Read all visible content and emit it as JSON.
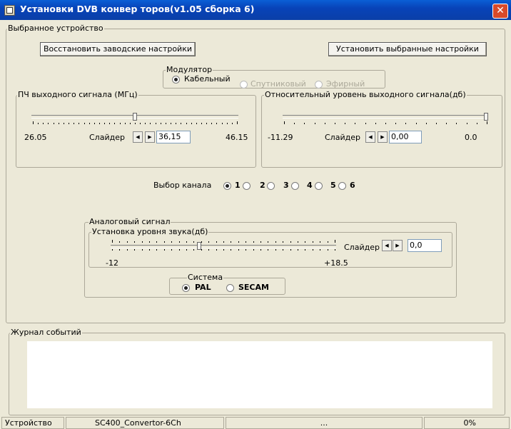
{
  "window": {
    "title": "Установки DVB конвер торов(v1.05 сборка 6)",
    "close_label": "✕"
  },
  "device_group": {
    "label": "Выбранное устройство",
    "restore_button": "Восстановить заводские настройки",
    "apply_button": "Установить выбранные настройки"
  },
  "modulator": {
    "label": "Модулятор",
    "options": [
      "Кабельный",
      "Спутниковый",
      "Эфирный"
    ],
    "selected": "Кабельный"
  },
  "if_output": {
    "label": "ПЧ выходного сигнала (МГц)",
    "min": "26.05",
    "max": "46.15",
    "slider_label": "Слайдер",
    "value": "36,15",
    "level": 0.5
  },
  "relative_level": {
    "label": "Относительный уровень выходного сигнала(дб)",
    "min": "-11.29",
    "max": "0.0",
    "slider_label": "Слайдер",
    "value": "0,00",
    "level": 1.0
  },
  "channel": {
    "label": "Выбор канала",
    "options": [
      "1",
      "2",
      "3",
      "4",
      "5",
      "6"
    ],
    "selected": "1"
  },
  "analog": {
    "label": "Аналоговый сигнал",
    "sound_group_label": "Установка уровня звука(дб)",
    "min": "-12",
    "max": "+18.5",
    "slider_label": "Слайдер",
    "value": "0,0",
    "level": 0.39
  },
  "system": {
    "label": "Система",
    "options": [
      "PAL",
      "SECAM"
    ],
    "selected": "PAL"
  },
  "log": {
    "label": "Журнал событий"
  },
  "status_bar": {
    "device_label": "Устройство",
    "device_name": "SC400_Convertor-6Ch",
    "message": "...",
    "progress": "0%"
  }
}
